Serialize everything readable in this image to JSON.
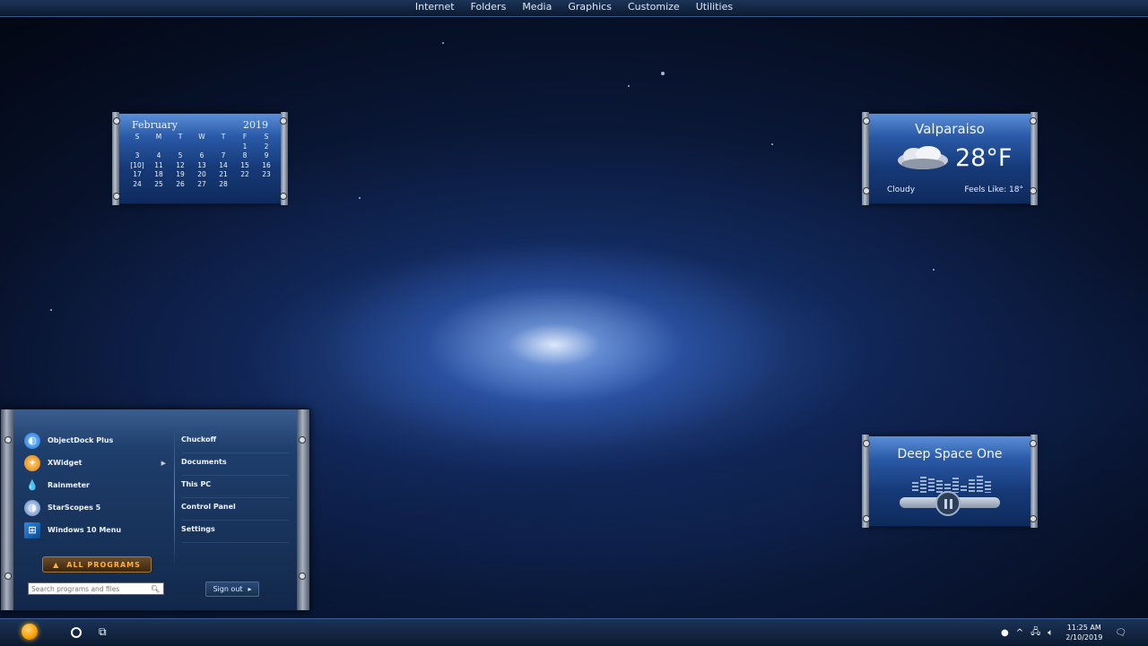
{
  "top_menu": [
    "Internet",
    "Folders",
    "Media",
    "Graphics",
    "Customize",
    "Utilities"
  ],
  "calendar": {
    "month": "February",
    "year": "2019",
    "weekdays": [
      "S",
      "M",
      "T",
      "W",
      "T",
      "F",
      "S"
    ],
    "days": [
      "",
      "",
      "",
      "",
      "",
      "1",
      "2",
      "3",
      "4",
      "5",
      "6",
      "7",
      "8",
      "9",
      "[10]",
      "11",
      "12",
      "13",
      "14",
      "15",
      "16",
      "17",
      "18",
      "19",
      "20",
      "21",
      "22",
      "23",
      "24",
      "25",
      "26",
      "27",
      "28",
      "",
      ""
    ]
  },
  "weather": {
    "city": "Valparaiso",
    "temperature": "28°F",
    "condition": "Cloudy",
    "feels_like": "Feels Like: 18°"
  },
  "music": {
    "title": "Deep Space One",
    "bar_levels": [
      0.6,
      0.9,
      0.8,
      0.7,
      0.5,
      0.85,
      0.4,
      0.75,
      0.95,
      0.65
    ]
  },
  "start_menu": {
    "programs": [
      {
        "label": "ObjectDock Plus",
        "icon": "objectdock-icon",
        "submenu": false
      },
      {
        "label": "XWidget",
        "icon": "xwidget-icon",
        "submenu": true
      },
      {
        "label": "Rainmeter",
        "icon": "rainmeter-icon",
        "submenu": false
      },
      {
        "label": "StarScopes 5",
        "icon": "starscopes-icon",
        "submenu": false
      },
      {
        "label": "Windows 10 Menu",
        "icon": "windows-icon",
        "submenu": false
      }
    ],
    "links": [
      "Chuckoff",
      "Documents",
      "This PC",
      "Control Panel",
      "Settings"
    ],
    "all_programs": "ALL PROGRAMS",
    "search_placeholder": "Search programs and files",
    "sign_out": "Sign out"
  },
  "taskbar": {
    "time": "11:25 AM",
    "date": "2/10/2019"
  }
}
